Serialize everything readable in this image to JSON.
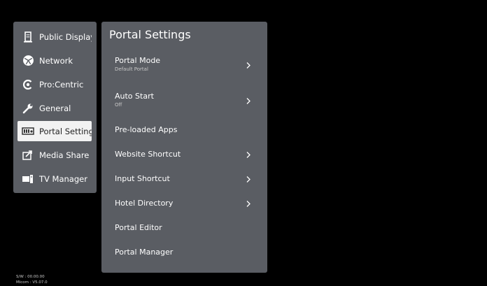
{
  "sidebar": {
    "items": [
      {
        "label": "Public Display...",
        "icon": "building-icon"
      },
      {
        "label": "Network",
        "icon": "network-globe-icon"
      },
      {
        "label": "Pro:Centric",
        "icon": "procentric-icon"
      },
      {
        "label": "General",
        "icon": "wrench-icon"
      },
      {
        "label": "Portal Settings",
        "icon": "portal-icon",
        "selected": true
      },
      {
        "label": "Media Share",
        "icon": "media-share-icon"
      },
      {
        "label": "TV Manager",
        "icon": "tv-manager-icon"
      }
    ]
  },
  "panel": {
    "title": "Portal Settings",
    "items": [
      {
        "label": "Portal Mode",
        "sub": "Default Portal",
        "arrow": true
      },
      {
        "label": "Auto Start",
        "sub": "Off",
        "arrow": true
      },
      {
        "label": "Pre-loaded Apps",
        "sub": "",
        "arrow": false
      },
      {
        "label": "Website Shortcut",
        "sub": "",
        "arrow": true
      },
      {
        "label": "Input Shortcut",
        "sub": "",
        "arrow": true
      },
      {
        "label": "Hotel Directory",
        "sub": "",
        "arrow": true
      },
      {
        "label": "Portal Editor",
        "sub": "",
        "arrow": false
      },
      {
        "label": "Portal Manager",
        "sub": "",
        "arrow": false
      }
    ]
  },
  "footer": {
    "sw": "S/W : 00.00.00",
    "micom": "Micom : V5.07.0"
  },
  "colors": {
    "background": "#000000",
    "panel": "#5a5d63",
    "selected": "#f2f2f2"
  }
}
